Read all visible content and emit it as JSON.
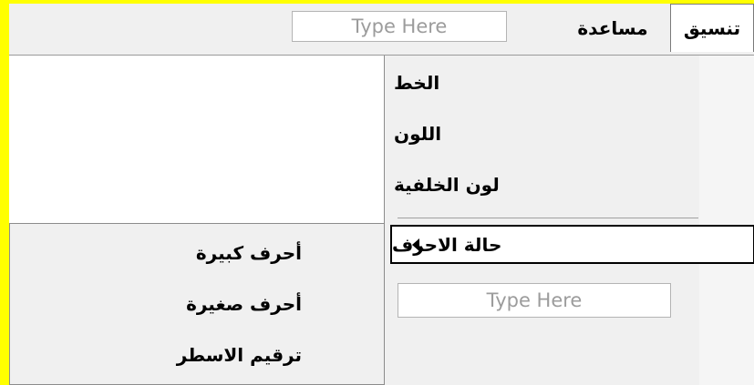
{
  "menubar": {
    "format_label": "تنسيق",
    "help_label": "مساعدة",
    "type_here": "Type Here"
  },
  "format_menu": {
    "items": [
      "الخط",
      "اللون",
      "لون الخلفية"
    ],
    "case_label": "حالة الاحرف",
    "type_here": "Type Here"
  },
  "case_submenu": {
    "items": [
      "أحرف كبيرة",
      "أحرف صغيرة",
      "ترقيم الاسطر"
    ]
  }
}
